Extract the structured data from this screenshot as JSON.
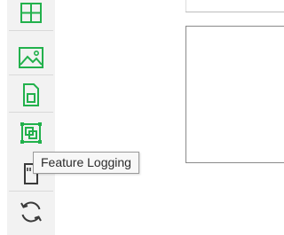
{
  "toolbar": {
    "accent_color": "#22b14c",
    "icon_dark_color": "#3a3a3a",
    "buttons": [
      {
        "icon": "grid-icon"
      },
      {
        "icon": "image-icon"
      },
      {
        "icon": "document-page-icon"
      },
      {
        "icon": "feature-logging-icon"
      },
      {
        "icon": "storage-card-icon"
      },
      {
        "icon": "refresh-icon"
      }
    ]
  },
  "tooltip": {
    "text": "Feature Logging"
  }
}
